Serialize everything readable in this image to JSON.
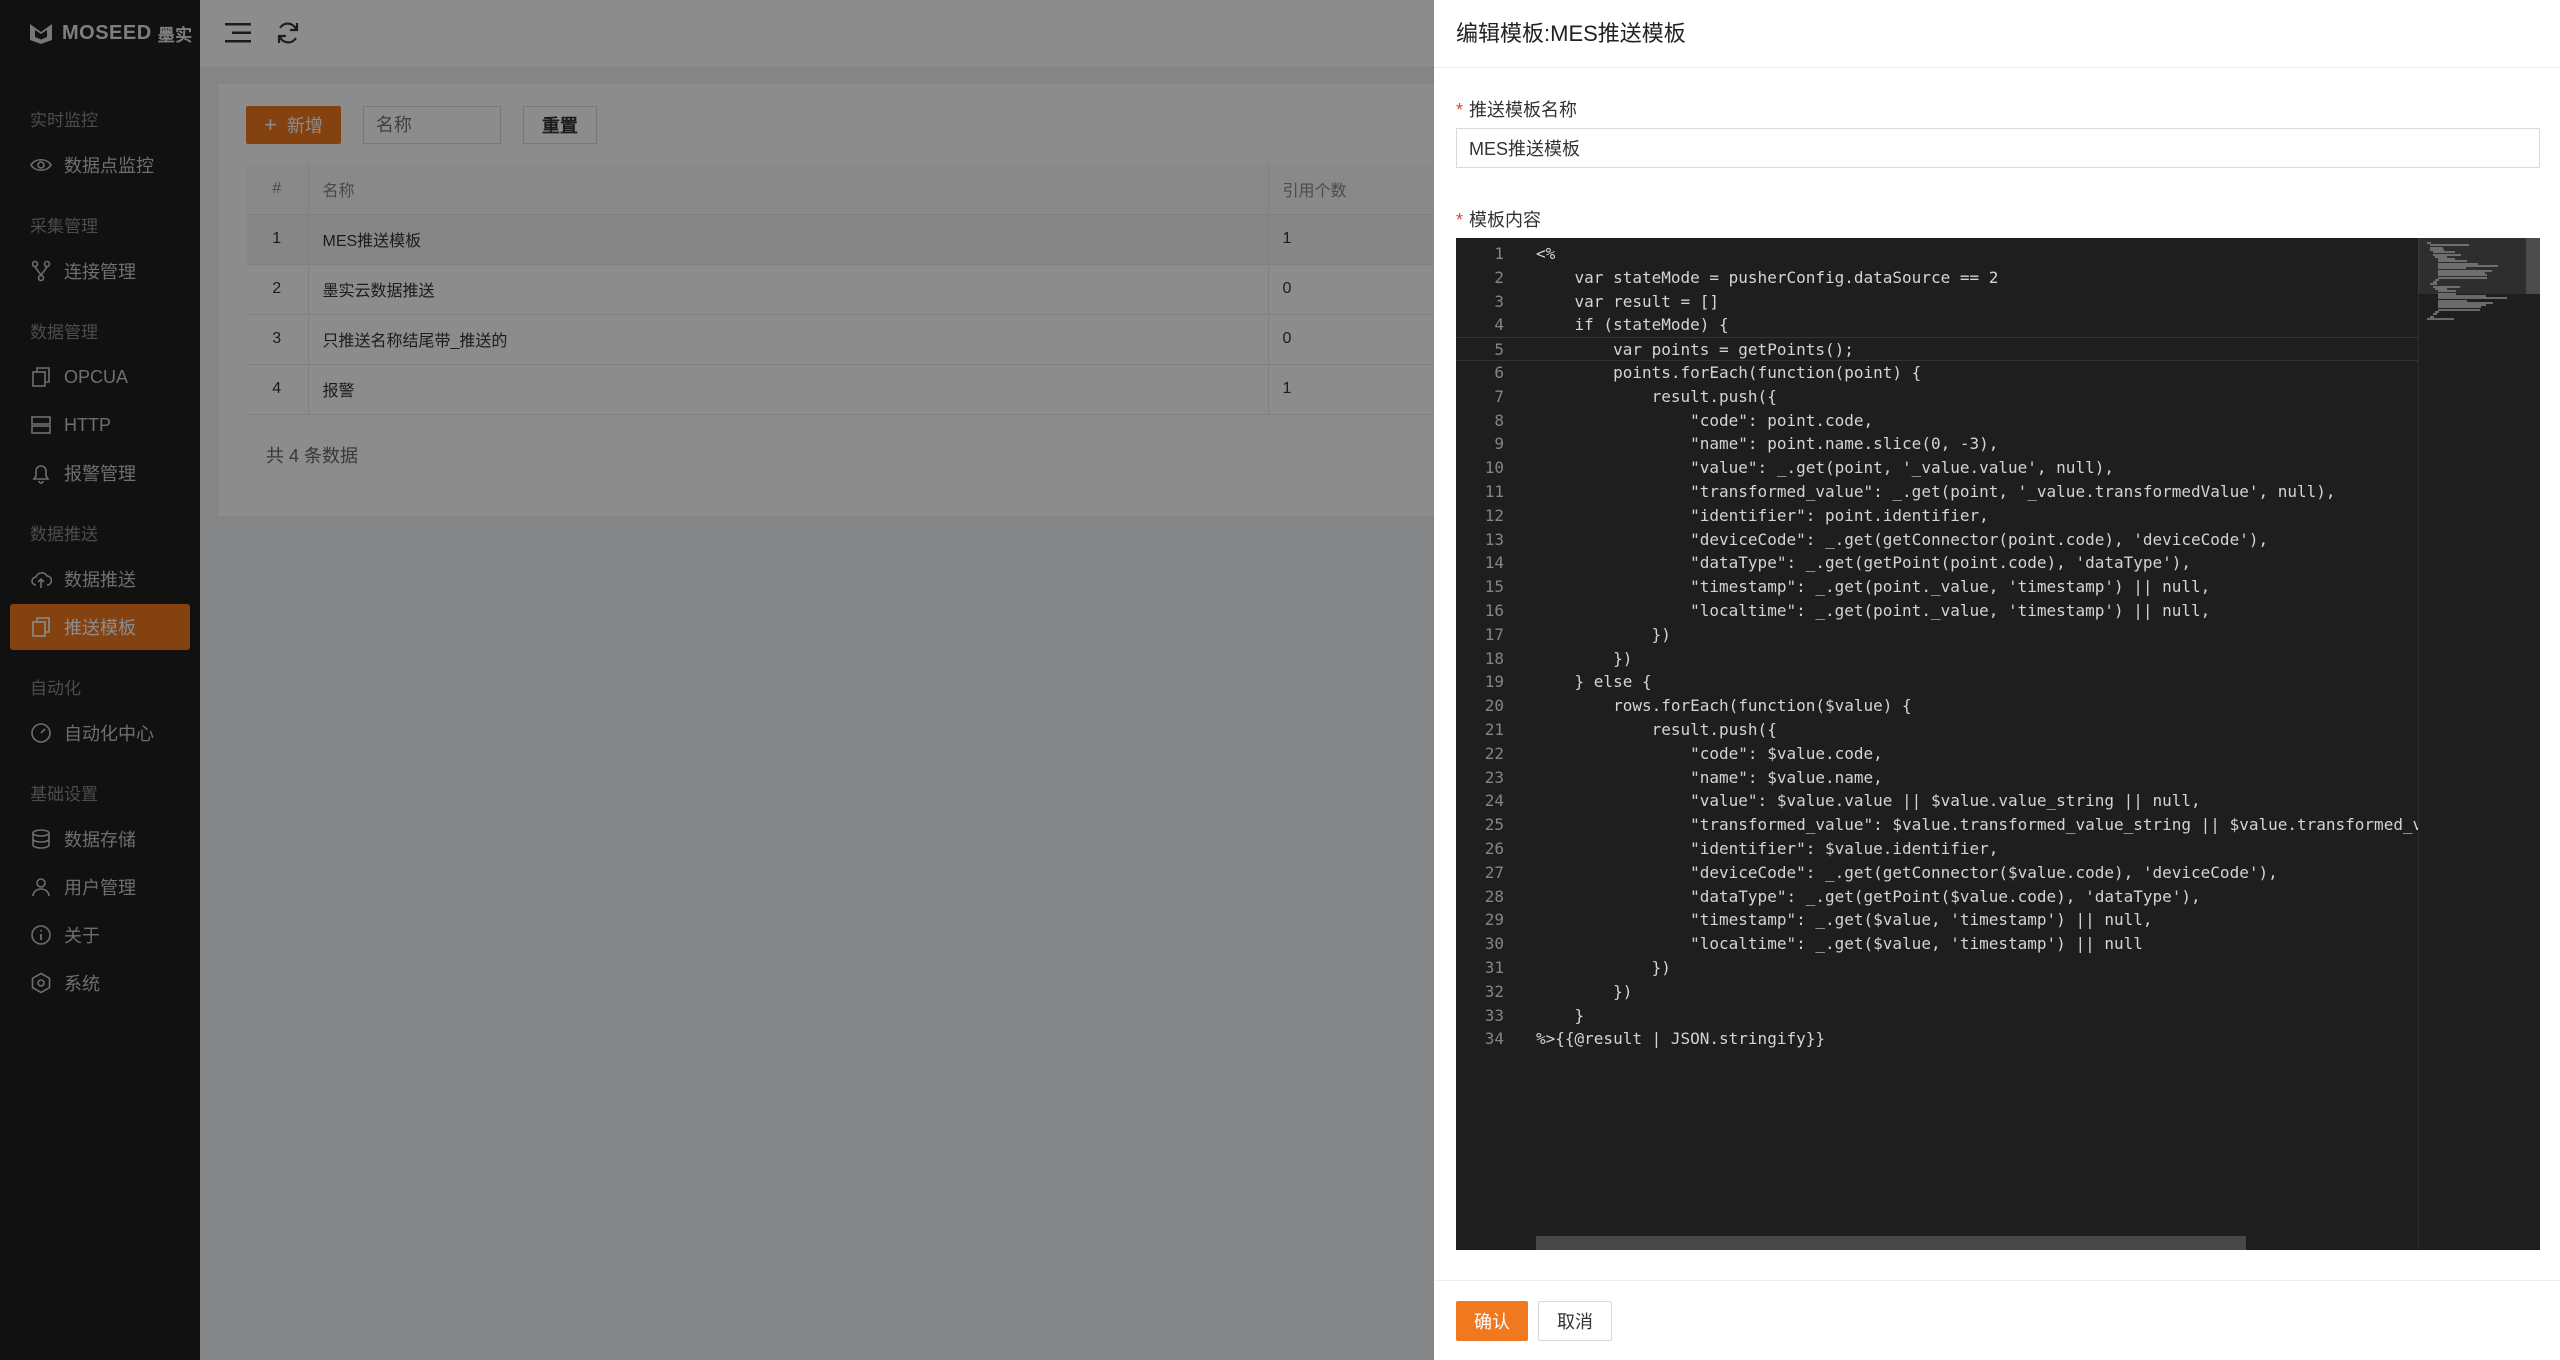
{
  "app": {
    "logo_text": "MOSEED",
    "logo_cn": "墨实"
  },
  "sidebar": {
    "groups": [
      {
        "label": "实时监控",
        "items": [
          {
            "label": "数据点监控",
            "icon": "eye-icon"
          }
        ]
      },
      {
        "label": "采集管理",
        "items": [
          {
            "label": "连接管理",
            "icon": "branch-icon"
          }
        ]
      },
      {
        "label": "数据管理",
        "items": [
          {
            "label": "OPCUA",
            "icon": "copy-icon"
          },
          {
            "label": "HTTP",
            "icon": "server-icon"
          },
          {
            "label": "报警管理",
            "icon": "bell-icon"
          }
        ]
      },
      {
        "label": "数据推送",
        "items": [
          {
            "label": "数据推送",
            "icon": "cloud-upload-icon"
          },
          {
            "label": "推送模板",
            "icon": "files-icon",
            "active": true
          }
        ]
      },
      {
        "label": "自动化",
        "items": [
          {
            "label": "自动化中心",
            "icon": "gauge-icon"
          }
        ]
      },
      {
        "label": "基础设置",
        "items": [
          {
            "label": "数据存储",
            "icon": "database-icon"
          },
          {
            "label": "用户管理",
            "icon": "user-icon"
          },
          {
            "label": "关于",
            "icon": "info-icon"
          },
          {
            "label": "系统",
            "icon": "settings-icon"
          }
        ]
      }
    ],
    "active_color": "#f0781e"
  },
  "list": {
    "add_label": "新增",
    "search_placeholder": "名称",
    "reset_label": "重置",
    "columns": [
      "#",
      "名称",
      "引用个数"
    ],
    "rows": [
      {
        "idx": "1",
        "name": "MES推送模板",
        "refs": "1"
      },
      {
        "idx": "2",
        "name": "墨实云数据推送",
        "refs": "0"
      },
      {
        "idx": "3",
        "name": "只推送名称结尾带_推送的",
        "refs": "0"
      },
      {
        "idx": "4",
        "name": "报警",
        "refs": "1"
      }
    ],
    "total_text": "共 4 条数据"
  },
  "drawer": {
    "title": "编辑模板:MES推送模板",
    "name_label": "推送模板名称",
    "name_value": "MES推送模板",
    "content_label": "模板内容",
    "code_lines": [
      "<%",
      "    var stateMode = pusherConfig.dataSource == 2",
      "    var result = []",
      "    if (stateMode) {",
      "        var points = getPoints();",
      "        points.forEach(function(point) {",
      "            result.push({",
      "                \"code\": point.code,",
      "                \"name\": point.name.slice(0, -3),",
      "                \"value\": _.get(point, '_value.value', null),",
      "                \"transformed_value\": _.get(point, '_value.transformedValue', null),",
      "                \"identifier\": point.identifier,",
      "                \"deviceCode\": _.get(getConnector(point.code), 'deviceCode'),",
      "                \"dataType\": _.get(getPoint(point.code), 'dataType'),",
      "                \"timestamp\": _.get(point._value, 'timestamp') || null,",
      "                \"localtime\": _.get(point._value, 'timestamp') || null,",
      "            })",
      "        })",
      "    } else {",
      "        rows.forEach(function($value) {",
      "            result.push({",
      "                \"code\": $value.code,",
      "                \"name\": $value.name,",
      "                \"value\": $value.value || $value.value_string || null,",
      "                \"transformed_value\": $value.transformed_value_string || $value.transformed_v",
      "                \"identifier\": $value.identifier,",
      "                \"deviceCode\": _.get(getConnector($value.code), 'deviceCode'),",
      "                \"dataType\": _.get(getPoint($value.code), 'dataType'),",
      "                \"timestamp\": _.get($value, 'timestamp') || null,",
      "                \"localtime\": _.get($value, 'timestamp') || null",
      "            })",
      "        })",
      "    }",
      "%>{{@result | JSON.stringify}}"
    ],
    "ok_label": "确认",
    "cancel_label": "取消"
  }
}
